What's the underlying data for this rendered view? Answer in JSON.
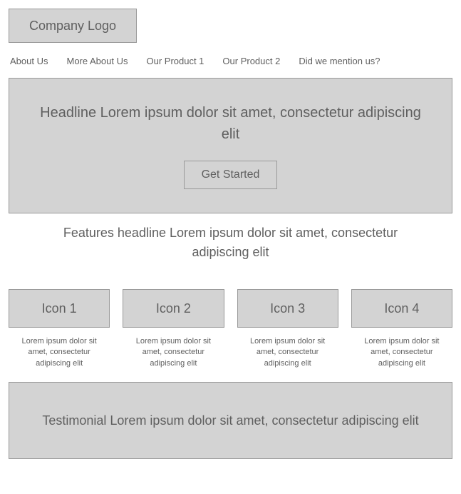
{
  "logo": {
    "text": "Company Logo"
  },
  "nav": {
    "items": [
      {
        "label": "About Us"
      },
      {
        "label": "More About Us"
      },
      {
        "label": "Our Product 1"
      },
      {
        "label": "Our Product 2"
      },
      {
        "label": "Did we mention us?"
      }
    ]
  },
  "hero": {
    "headline": "Headline Lorem ipsum dolor sit amet, consectetur adipiscing elit",
    "cta_label": "Get Started"
  },
  "features": {
    "headline": "Features headline Lorem ipsum dolor sit amet, consectetur adipiscing elit",
    "items": [
      {
        "icon_label": "Icon 1",
        "desc": "Lorem ipsum dolor sit amet, consectetur adipiscing elit"
      },
      {
        "icon_label": "Icon 2",
        "desc": "Lorem ipsum dolor sit amet, consectetur adipiscing elit"
      },
      {
        "icon_label": "Icon 3",
        "desc": "Lorem ipsum dolor sit amet, consectetur adipiscing elit"
      },
      {
        "icon_label": "Icon 4",
        "desc": "Lorem ipsum dolor sit amet, consectetur adipiscing elit"
      }
    ]
  },
  "testimonial": {
    "text": "Testimonial Lorem ipsum dolor sit amet, consectetur adipiscing elit"
  }
}
